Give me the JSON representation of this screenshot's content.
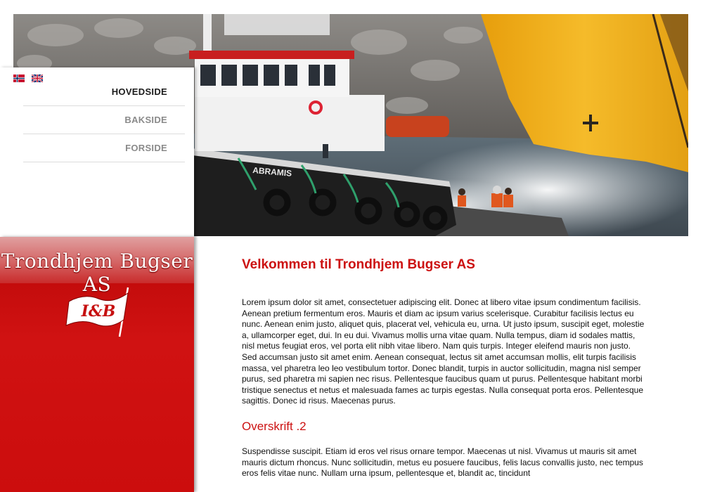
{
  "languages": [
    {
      "code": "no",
      "name": "Norwegian"
    },
    {
      "code": "en",
      "name": "English"
    }
  ],
  "menu": {
    "items": [
      {
        "label": "HOVEDSIDE",
        "active": true
      },
      {
        "label": "BAKSIDE",
        "active": false
      },
      {
        "label": "FORSIDE",
        "active": false
      }
    ]
  },
  "hero": {
    "boat_name": "ABRAMIS"
  },
  "brand": {
    "name": "Trondhjem Bugser AS",
    "logo_letters": "I&B"
  },
  "content": {
    "title": "Velkommen til Trondhjem Bugser AS",
    "paragraph1": "Lorem ipsum dolor sit amet, consectetuer adipiscing elit. Donec at libero vitae ipsum condimentum facilisis. Aenean pretium fermentum eros. Mauris et diam ac ipsum varius scelerisque. Curabitur facilisis lectus eu nunc. Aenean enim justo, aliquet quis, placerat vel, vehicula eu, urna. Ut justo ipsum, suscipit eget, molestie a, ullamcorper eget, dui. In eu dui. Vivamus mollis urna vitae quam. Nulla tempus, diam id sodales mattis, nisl metus feugiat eros, vel porta elit nibh vitae libero. Nam quis turpis. Integer eleifend mauris non justo. Sed accumsan justo sit amet enim. Aenean consequat, lectus sit amet accumsan mollis, elit turpis facilisis massa, vel pharetra leo leo vestibulum tortor. Donec blandit, turpis in auctor sollicitudin, magna nisl semper purus, sed pharetra mi sapien nec risus. Pellentesque faucibus quam ut purus. Pellentesque habitant morbi tristique senectus et netus et malesuada fames ac turpis egestas. Nulla consequat porta eros. Pellentesque sagittis. Donec id risus. Maecenas purus.",
    "subtitle": "Overskrift .2",
    "paragraph2": "Suspendisse suscipit. Etiam id eros vel risus ornare tempor. Maecenas ut nisl. Vivamus ut mauris sit amet mauris dictum rhoncus. Nunc sollicitudin, metus eu posuere faucibus, felis lacus convallis justo, nec tempus eros felis vitae nunc. Nullam urna ipsum, pellentesque et, blandit ac, tincidunt"
  },
  "colors": {
    "accent": "#cc1111",
    "sidebar": "#c61010",
    "hull_yellow": "#f0b418"
  }
}
